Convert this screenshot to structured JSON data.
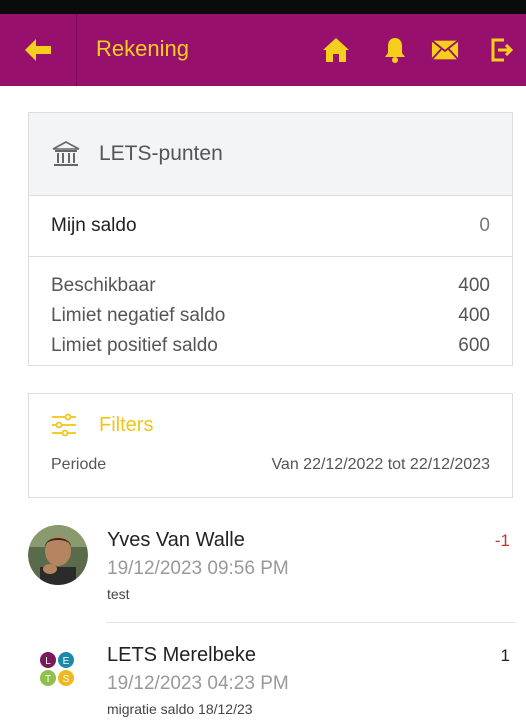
{
  "header": {
    "title": "Rekening",
    "colors": {
      "bar": "#98106d",
      "accent": "#f5cf1c"
    },
    "icons": [
      "arrow-left-icon",
      "home-icon",
      "bell-icon",
      "envelope-icon",
      "logout-icon"
    ]
  },
  "account_card": {
    "title": "LETS-punten",
    "icon": "bank-icon",
    "saldo_label": "Mijn saldo",
    "saldo_value": "0",
    "limits": [
      {
        "label": "Beschikbaar",
        "value": "400"
      },
      {
        "label": "Limiet negatief saldo",
        "value": "400"
      },
      {
        "label": "Limiet positief saldo",
        "value": "600"
      }
    ]
  },
  "filters": {
    "title": "Filters",
    "icon": "sliders-icon",
    "period_label": "Periode",
    "period_value": "Van 22/12/2022 tot 22/12/2023"
  },
  "transactions": [
    {
      "name": "Yves Van Walle",
      "datetime": "19/12/2023 09:56 PM",
      "description": "test",
      "amount": "-1",
      "amount_color": "#c0392b"
    },
    {
      "name": "LETS Merelbeke",
      "datetime": "19/12/2023 04:23 PM",
      "description": "migratie saldo 18/12/23",
      "amount": "1",
      "amount_color": "#222222",
      "logo_letters": [
        "L",
        "E",
        "T",
        "S"
      ]
    }
  ]
}
